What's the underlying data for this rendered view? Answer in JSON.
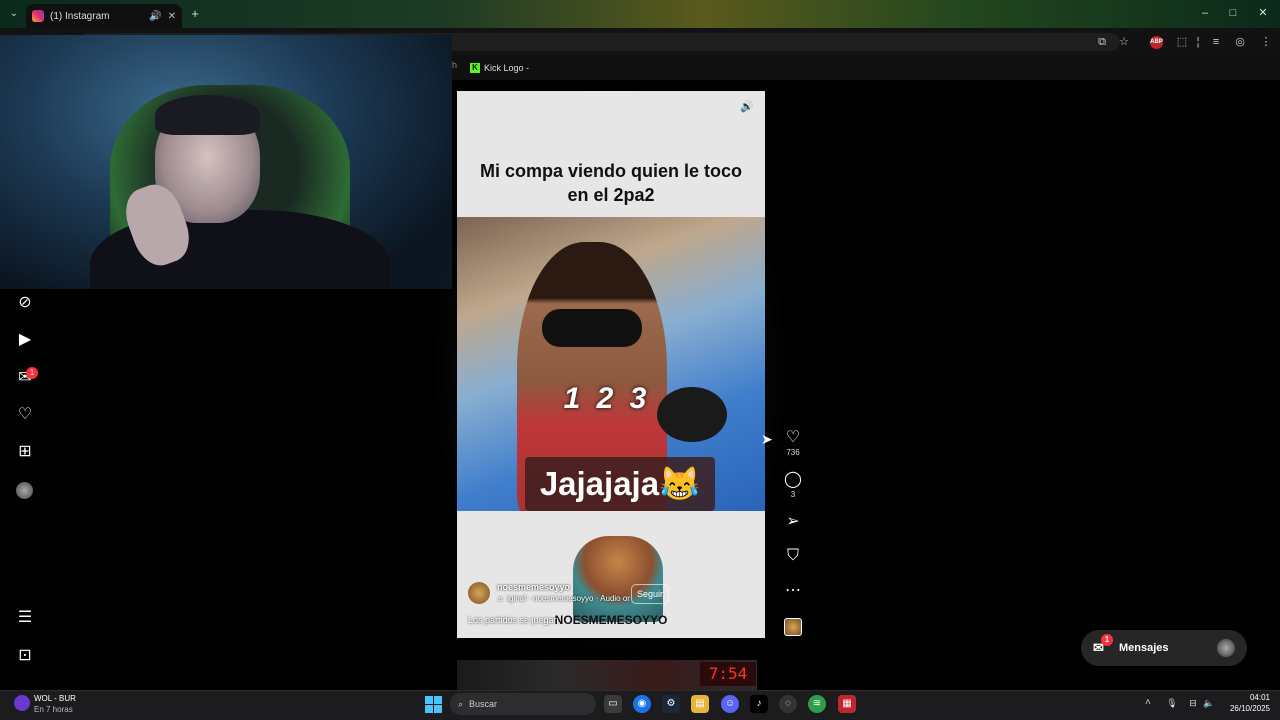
{
  "browser": {
    "tab_title": "(1) Instagram",
    "tab_list_icon": "⌄",
    "new_tab_icon": "+",
    "bookmark_partial": "h",
    "bookmark_kick": "Kick Logo -",
    "window_controls": [
      "–",
      "□",
      "✕"
    ],
    "toolbar_icons": [
      "install-icon",
      "star-icon",
      "adblock-icon",
      "extensions-icon",
      "reading-list-icon",
      "profile-icon",
      "menu-icon"
    ],
    "abp_label": "ABP"
  },
  "nav": {
    "items": [
      "explore",
      "reels",
      "messages",
      "notifications",
      "create",
      "profile",
      "more",
      "also-from-meta"
    ],
    "messages_badge": "1"
  },
  "reel": {
    "title": "Mi compa viendo quien le toco en el 2pa2",
    "overlay_count": "1 2 3",
    "overlay_caption": "Jajajaja😹",
    "meme_watermark": "NOESMEMESOYYO",
    "account": "noesmemesoyyo",
    "audio": "♬ iginal · noesmemesoyyo · Audio or",
    "follow_label": "Seguir",
    "description": "Los partidos se juegan",
    "likes": "736",
    "comments": "3",
    "next_timer": "7:54"
  },
  "messages": {
    "label": "Mensajes",
    "badge": "1"
  },
  "taskbar": {
    "weather_title": "WOL - BUR",
    "weather_sub": "En 7 horas",
    "search_placeholder": "Buscar",
    "time": "04:01",
    "date": "26/10/2025"
  },
  "colors": {
    "instagram_red": "#ff3040",
    "kick_green": "#53fc18",
    "windows_blue": "#4cc2ff"
  }
}
